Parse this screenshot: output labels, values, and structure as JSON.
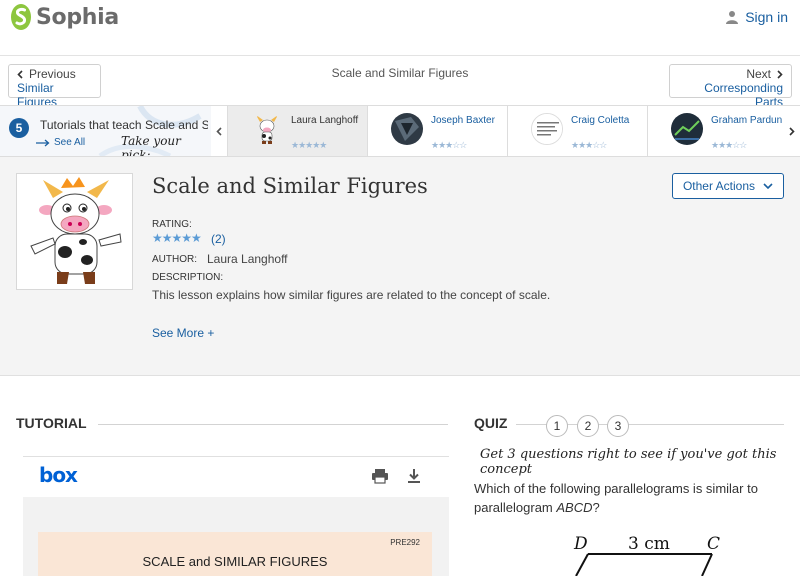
{
  "header": {
    "brand": "Sophia",
    "signin_label": "Sign in"
  },
  "nav": {
    "prev_small": "Previous",
    "prev_link": "Similar Figures",
    "title": "Scale and Similar Figures",
    "next_small": "Next",
    "next_link": "Corresponding Parts"
  },
  "strip": {
    "count": "5",
    "title": "Tutorials that teach Scale and S",
    "see_all": "See All",
    "pick": "Take your pick:",
    "tutors": [
      {
        "name": "Laura Langhoff",
        "stars": "★★★★★"
      },
      {
        "name": "Joseph Baxter",
        "stars": "★★★☆☆"
      },
      {
        "name": "Craig Coletta",
        "stars": "★★★☆☆"
      },
      {
        "name": "Graham Pardun",
        "stars": "★★★☆☆"
      }
    ]
  },
  "info": {
    "title": "Scale and Similar Figures",
    "other_actions": "Other Actions",
    "rating_label": "Rating:",
    "rating_stars": "★★★★★",
    "rating_count": "(2)",
    "author_label": "Author:",
    "author_name": "Laura Langhoff",
    "description_label": "Description:",
    "description": "This lesson explains how similar figures are related to the concept of scale.",
    "see_more": "See More +"
  },
  "tutorial": {
    "heading": "TUTORIAL",
    "viewer_brand": "box",
    "doc_code": "PRE292",
    "doc_title": "SCALE and SIMILAR FIGURES"
  },
  "quiz": {
    "heading": "QUIZ",
    "questions": [
      "1",
      "2",
      "3"
    ],
    "prompt": "Get 3 questions right to see if you've got this concept",
    "question_pre": "Which of the following parallelograms is similar to parallelogram ",
    "question_var": "ABCD",
    "question_post": "?",
    "figure": {
      "vertex_d": "D",
      "vertex_c": "C",
      "side_label": "3 cm"
    }
  },
  "colors": {
    "accent": "#1a5fa0",
    "logo_green": "#8dc63f"
  }
}
